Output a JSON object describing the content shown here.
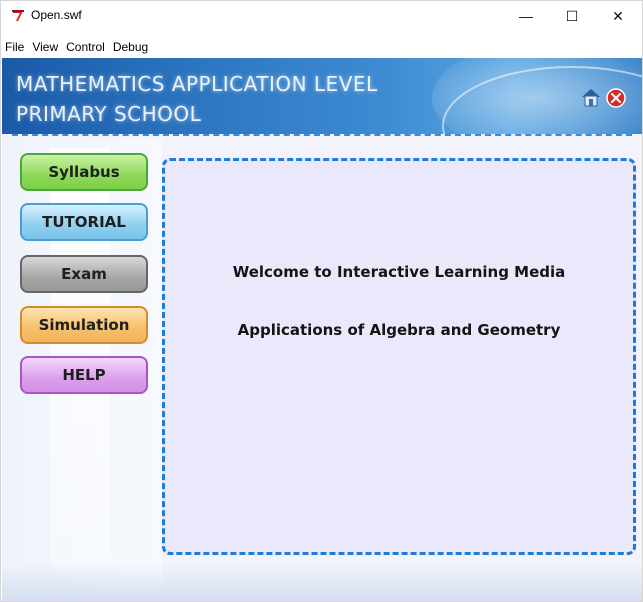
{
  "window": {
    "title": "Open.swf",
    "controls": {
      "minimize": "—",
      "maximize": "☐",
      "close": "✕"
    }
  },
  "menu": [
    "File",
    "View",
    "Control",
    "Debug"
  ],
  "header": {
    "line1": "MATHEMATICS APPLICATION LEVEL",
    "line2": "PRIMARY SCHOOL",
    "icons": [
      "home-icon",
      "exit-icon"
    ]
  },
  "nav": {
    "syllabus": "Syllabus",
    "tutorial": "TUTORIAL",
    "exam": "Exam",
    "simulation": "Simulation",
    "help": "HELP"
  },
  "content": {
    "welcome": "Welcome to Interactive Learning Media",
    "subtitle": "Applications of Algebra and Geometry"
  },
  "colors": {
    "header_blue": "#2f79c4",
    "panel_border": "#1e7bd8",
    "panel_fill": "#e9e9fb"
  }
}
